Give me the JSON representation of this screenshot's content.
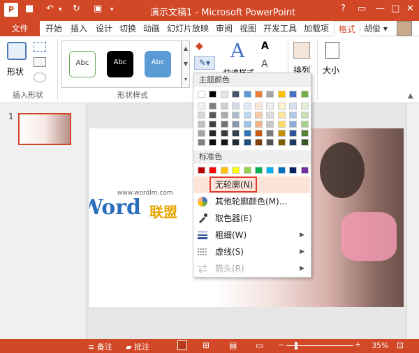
{
  "window": {
    "title": "演示文稿1 - Microsoft PowerPoint",
    "user": "胡俊"
  },
  "tabs": [
    {
      "label": "文件",
      "active": false
    },
    {
      "label": "开始",
      "active": false
    },
    {
      "label": "插入",
      "active": false
    },
    {
      "label": "设计",
      "active": false
    },
    {
      "label": "切换",
      "active": false
    },
    {
      "label": "动画",
      "active": false
    },
    {
      "label": "幻灯片放映",
      "active": false
    },
    {
      "label": "审阅",
      "active": false
    },
    {
      "label": "视图",
      "active": false
    },
    {
      "label": "开发工具",
      "active": false
    },
    {
      "label": "加载项",
      "active": false
    },
    {
      "label": "格式",
      "active": true
    }
  ],
  "ribbon": {
    "shape_label": "形状",
    "insert_shapes_group": "插入形状",
    "shape_styles_group": "形状样式",
    "style_presets": [
      "Abc",
      "Abc",
      "Abc"
    ],
    "quick_styles": "快速样式",
    "arrange": "排列",
    "size": "大小"
  },
  "thumbnails": {
    "slide_number": "1"
  },
  "watermark": {
    "url": "www.wordlm.com",
    "brand_latin": "Word",
    "brand_cn": "联盟"
  },
  "outline_menu": {
    "theme_colors_header": "主题颜色",
    "standard_colors_header": "标准色",
    "theme_row": [
      "#ffffff",
      "#000000",
      "#e7e6e6",
      "#44546a",
      "#5b9bd5",
      "#ed7d31",
      "#a5a5a5",
      "#ffc000",
      "#4472c4",
      "#70ad47"
    ],
    "theme_shades": [
      [
        "#f2f2f2",
        "#7f7f7f",
        "#d0cece",
        "#d6dce4",
        "#deebf6",
        "#fbe5d5",
        "#ededed",
        "#fff2cc",
        "#d9e2f3",
        "#e2efd9"
      ],
      [
        "#d8d8d8",
        "#595959",
        "#aeabab",
        "#adb9ca",
        "#bdd7ee",
        "#f7cbac",
        "#dbdbdb",
        "#fee599",
        "#b4c6e7",
        "#c5e0b3"
      ],
      [
        "#bfbfbf",
        "#3f3f3f",
        "#757070",
        "#8496b0",
        "#9dc3e6",
        "#f4b183",
        "#c9c9c9",
        "#ffd965",
        "#8eaadb",
        "#a8d08d"
      ],
      [
        "#a5a5a5",
        "#262626",
        "#3a3838",
        "#323f4f",
        "#2e75b5",
        "#c55a11",
        "#7b7b7b",
        "#bf9000",
        "#2f5496",
        "#538135"
      ],
      [
        "#7f7f7f",
        "#0c0c0c",
        "#171616",
        "#222a35",
        "#1e4e79",
        "#833c0b",
        "#525252",
        "#7f6000",
        "#1f3864",
        "#375623"
      ]
    ],
    "standard_row": [
      "#c00000",
      "#ff0000",
      "#ffc000",
      "#ffff00",
      "#92d050",
      "#00b050",
      "#00b0f0",
      "#0070c0",
      "#002060",
      "#7030a0"
    ],
    "items": [
      {
        "label": "无轮廓(N)",
        "icon": "no-outline-icon",
        "has_arrow": false,
        "disabled": false,
        "highlighted": true
      },
      {
        "label": "其他轮廓颜色(M)...",
        "icon": "color-wheel-icon",
        "has_arrow": false,
        "disabled": false,
        "highlighted": false
      },
      {
        "label": "取色器(E)",
        "icon": "eyedropper-icon",
        "has_arrow": false,
        "disabled": false,
        "highlighted": false
      },
      {
        "label": "粗细(W)",
        "icon": "line-weight-icon",
        "has_arrow": true,
        "disabled": false,
        "highlighted": false
      },
      {
        "label": "虚线(S)",
        "icon": "dash-icon",
        "has_arrow": true,
        "disabled": false,
        "highlighted": false
      },
      {
        "label": "箭头(R)",
        "icon": "arrows-icon",
        "has_arrow": true,
        "disabled": true,
        "highlighted": false
      }
    ]
  },
  "status": {
    "notes": "备注",
    "comments": "批注",
    "zoom": "35%"
  }
}
